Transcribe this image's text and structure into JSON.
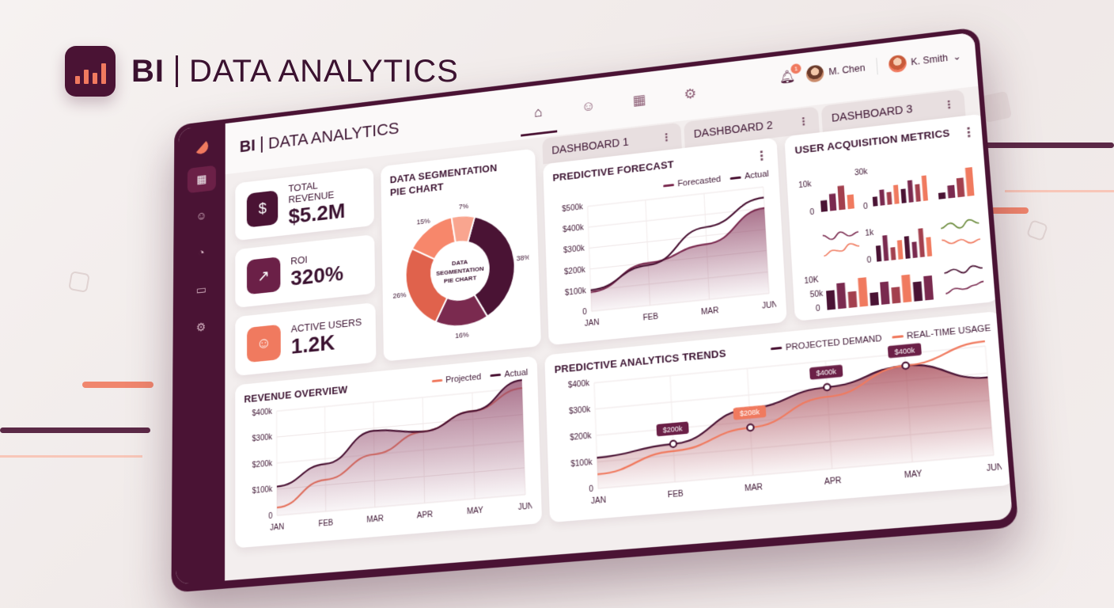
{
  "hero": {
    "brand_bold": "BI",
    "brand_rest": "DATA ANALYTICS"
  },
  "app": {
    "brand_bold": "BI",
    "brand_rest": "DATA ANALYTICS"
  },
  "nav": [
    "home-icon",
    "users-icon",
    "calendar-icon",
    "gear-icon"
  ],
  "notifications": {
    "count": "1"
  },
  "users": [
    {
      "name": "M. Chen"
    },
    {
      "name": "K. Smith"
    }
  ],
  "tabs": [
    {
      "label": "DASHBOARD 1"
    },
    {
      "label": "DASHBOARD 2"
    },
    {
      "label": "DASHBOARD 3"
    }
  ],
  "kpis": [
    {
      "label": "TOTAL REVENUE",
      "value": "$5.2M",
      "icon": "revenue-cycle-icon",
      "color": "#4a1334"
    },
    {
      "label": "ROI",
      "value": "320%",
      "icon": "roi-coin-icon",
      "color": "#6b2047"
    },
    {
      "label": "ACTIVE USERS",
      "value": "1.2K",
      "icon": "users-icon",
      "color": "#f07a5f"
    }
  ],
  "colors": {
    "plum": "#4a1334",
    "wine": "#7a2a4f",
    "coral": "#f07a5f",
    "salmon": "#f7a48e"
  },
  "pie": {
    "title": "DATA SEGMENTATION PIE CHART",
    "center_label": "DATA SEGMENTATION PIE CHART",
    "chart_data": {
      "type": "pie",
      "slices": [
        {
          "label": "38%",
          "value": 38,
          "color": "#4a1334"
        },
        {
          "label": "16%",
          "value": 16,
          "color": "#7a2a4f"
        },
        {
          "label": "26%",
          "value": 26,
          "color": "#e0624c"
        },
        {
          "label": "15%",
          "value": 15,
          "color": "#f7876b"
        },
        {
          "label": "7%",
          "value": 7,
          "color": "#f9a58f"
        }
      ]
    }
  },
  "forecast": {
    "title": "PREDICTIVE FORECAST",
    "chart_data": {
      "type": "area",
      "categories": [
        "JAN",
        "FEB",
        "MAR",
        "JUN"
      ],
      "yticks": [
        "0",
        "$100k",
        "$200k",
        "$300k",
        "$400k",
        "$500k"
      ],
      "ylim": [
        0,
        500
      ],
      "series": [
        {
          "name": "Forecasted",
          "values": [
            90,
            200,
            260,
            400
          ]
        },
        {
          "name": "Actual",
          "values": [
            100,
            190,
            340,
            450
          ]
        }
      ]
    }
  },
  "acquisition": {
    "title": "USER ACQUISITION METRICS",
    "labels": [
      "10k",
      "0",
      "30k",
      "0",
      "1k",
      "0",
      "10K",
      "50k",
      "0"
    ]
  },
  "revenue": {
    "title": "REVENUE OVERVIEW",
    "chart_data": {
      "type": "area",
      "categories": [
        "JAN",
        "FEB",
        "MAR",
        "APR",
        "MAY",
        "JUN"
      ],
      "yticks": [
        "0",
        "$100k",
        "$200k",
        "$300k",
        "$400k"
      ],
      "ylim": [
        0,
        400
      ],
      "series": [
        {
          "name": "Projected",
          "values": [
            30,
            120,
            200,
            270,
            330,
            400
          ]
        },
        {
          "name": "Actual",
          "values": [
            110,
            180,
            290,
            270,
            330,
            430
          ]
        }
      ]
    }
  },
  "trends": {
    "title": "PREDICTIVE ANALYTICS TRENDS",
    "chart_data": {
      "type": "line",
      "categories": [
        "JAN",
        "FEB",
        "MAR",
        "APR",
        "MAY",
        "JUN"
      ],
      "yticks": [
        "0",
        "$100k",
        "$200k",
        "$300k",
        "$400k"
      ],
      "ylim": [
        0,
        450
      ],
      "series": [
        {
          "name": "PROJECTED DEMAND",
          "values": [
            130,
            160,
            280,
            340,
            400,
            320
          ]
        },
        {
          "name": "REAL-TIME USAGE",
          "values": [
            60,
            130,
            200,
            300,
            400,
            470
          ]
        }
      ],
      "callouts": [
        "$200k",
        "$208k",
        "$400k",
        "$400k"
      ]
    }
  }
}
